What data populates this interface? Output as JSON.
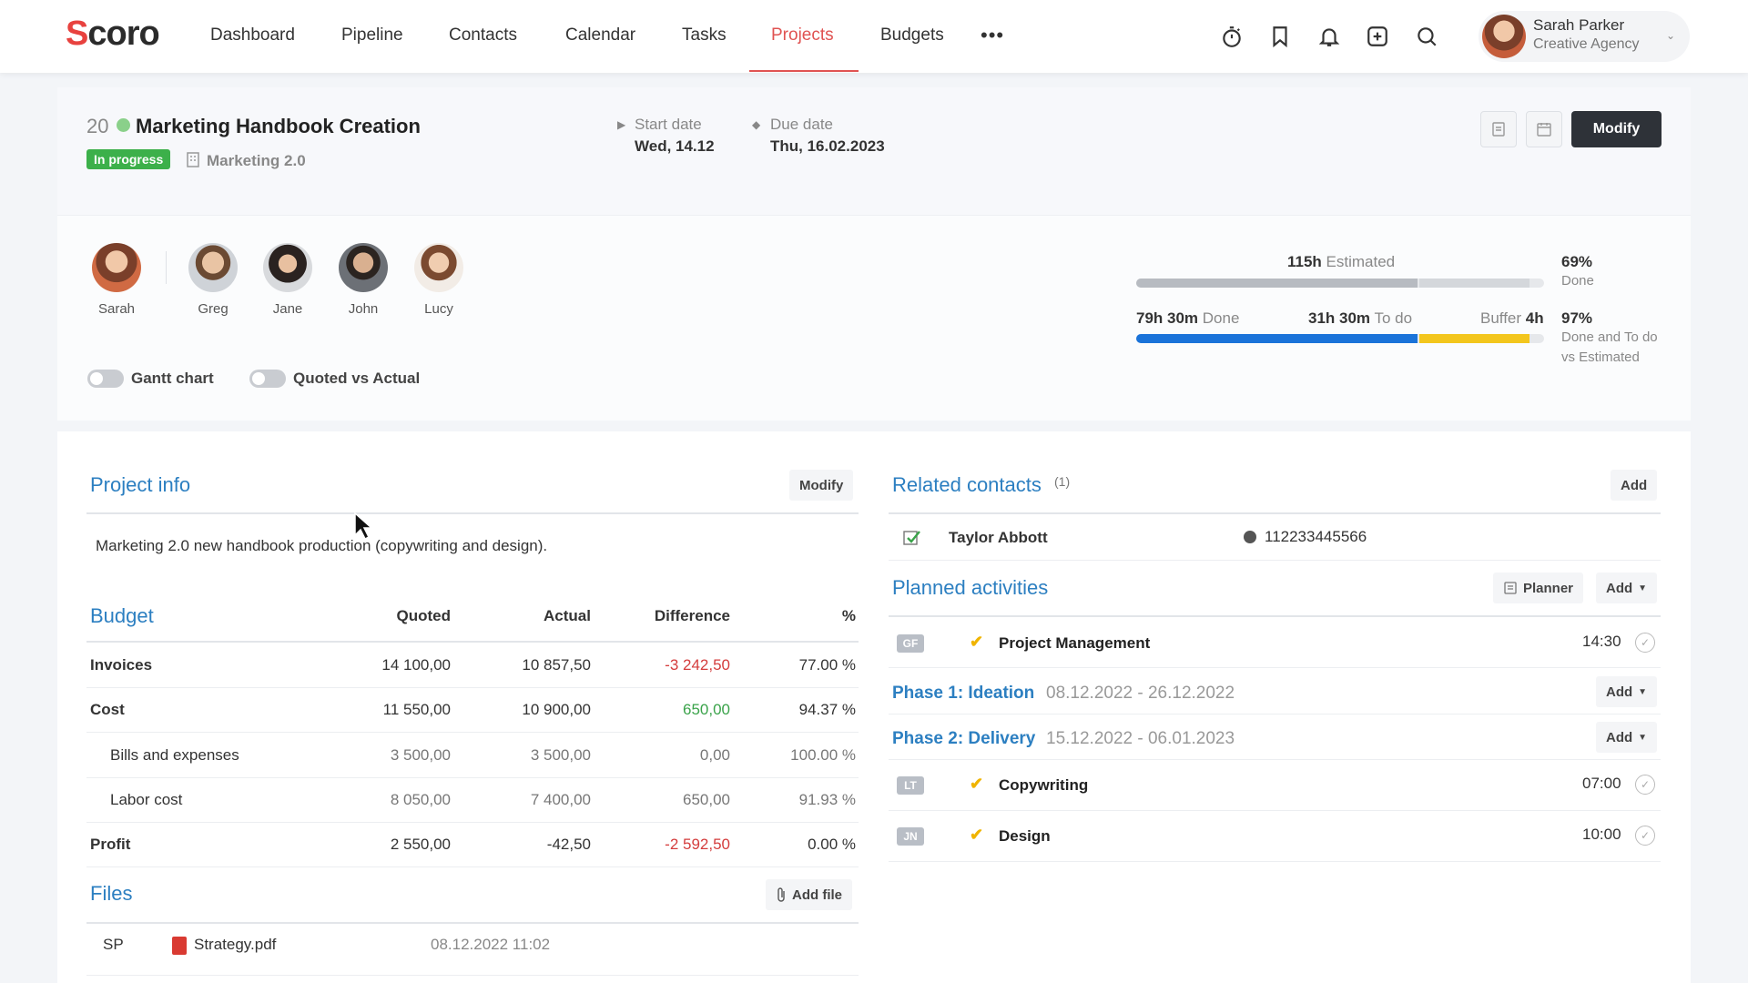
{
  "app": {
    "logo_text": "Scoro"
  },
  "nav": {
    "items": [
      "Dashboard",
      "Pipeline",
      "Contacts",
      "Calendar",
      "Tasks",
      "Projects",
      "Budgets"
    ],
    "active": "Projects",
    "more": "•••"
  },
  "toolbar_icons": [
    "timer-icon",
    "bookmark-icon",
    "bell-icon",
    "add-square-icon",
    "search-icon"
  ],
  "user": {
    "name": "Sarah Parker",
    "company": "Creative Agency"
  },
  "project": {
    "number": "20",
    "title": "Marketing Handbook Creation",
    "status": "In progress",
    "category": "Marketing 2.0",
    "start_label": "Start date",
    "start_value": "Wed, 14.12",
    "due_label": "Due date",
    "due_value": "Thu, 16.02.2023",
    "modify_label": "Modify"
  },
  "team": {
    "members": [
      "Sarah",
      "Greg",
      "Jane",
      "John",
      "Lucy"
    ]
  },
  "toggles": {
    "gantt": {
      "label": "Gantt chart",
      "on": false
    },
    "quoted": {
      "label": "Quoted vs Actual",
      "on": false
    }
  },
  "progress": {
    "estimated_value": "115h",
    "estimated_label": "Estimated",
    "done_value": "79h 30m",
    "done_label": "Done",
    "todo_value": "31h 30m",
    "todo_label": "To do",
    "buffer_label": "Buffer",
    "buffer_value": "4h",
    "pct_done": "69%",
    "pct_done_label": "Done",
    "pct_total": "97%",
    "pct_total_label_1": "Done and To do",
    "pct_total_label_2": "vs Estimated",
    "done_fraction": 0.69,
    "todo_fraction": 0.27
  },
  "project_info": {
    "title": "Project info",
    "modify_label": "Modify",
    "description": "Marketing 2.0 new handbook production (copywriting and design)."
  },
  "budget": {
    "title": "Budget",
    "columns": [
      "Quoted",
      "Actual",
      "Difference",
      "%"
    ],
    "rows": [
      {
        "label": "Invoices",
        "quoted": "14 100,00",
        "actual": "10 857,50",
        "difference": "-3 242,50",
        "pct": "77.00 %"
      },
      {
        "label": "Cost",
        "quoted": "11 550,00",
        "actual": "10 900,00",
        "difference": "650,00",
        "pct": "94.37 %"
      },
      {
        "label": "Bills and expenses",
        "quoted": "3 500,00",
        "actual": "3 500,00",
        "difference": "0,00",
        "pct": "100.00 %"
      },
      {
        "label": "Labor cost",
        "quoted": "8 050,00",
        "actual": "7 400,00",
        "difference": "650,00",
        "pct": "91.93 %"
      },
      {
        "label": "Profit",
        "quoted": "2 550,00",
        "actual": "-42,50",
        "difference": "-2 592,50",
        "pct": "0.00 %"
      }
    ]
  },
  "files": {
    "title": "Files",
    "add_label": "Add file",
    "items": [
      {
        "initials": "SP",
        "name": "Strategy.pdf",
        "date": "08.12.2022 11:02"
      }
    ]
  },
  "related_contacts": {
    "title": "Related contacts",
    "count": "(1)",
    "add_label": "Add",
    "items": [
      {
        "name": "Taylor Abbott",
        "phone": "112233445566"
      }
    ]
  },
  "planned_activities": {
    "title": "Planned activities",
    "planner_label": "Planner",
    "add_label": "Add",
    "top_activity": {
      "initials": "GF",
      "name": "Project Management",
      "time": "14:30"
    },
    "phases": [
      {
        "name": "Phase 1: Ideation",
        "dates": "08.12.2022 - 26.12.2022",
        "add_label": "Add"
      },
      {
        "name": "Phase 2: Delivery",
        "dates": "15.12.2022 - 06.01.2023",
        "add_label": "Add"
      }
    ],
    "phase2_activities": [
      {
        "initials": "LT",
        "name": "Copywriting",
        "time": "07:00"
      },
      {
        "initials": "JN",
        "name": "Design",
        "time": "10:00"
      }
    ]
  },
  "colors": {
    "accent_red": "#e05352",
    "link_blue": "#2c7fc1",
    "status_green": "#3cb04a",
    "done_blue": "#1a73d9",
    "todo_yellow": "#f3c61d",
    "negative_red": "#d43d3d",
    "positive_green": "#3aa34a"
  }
}
